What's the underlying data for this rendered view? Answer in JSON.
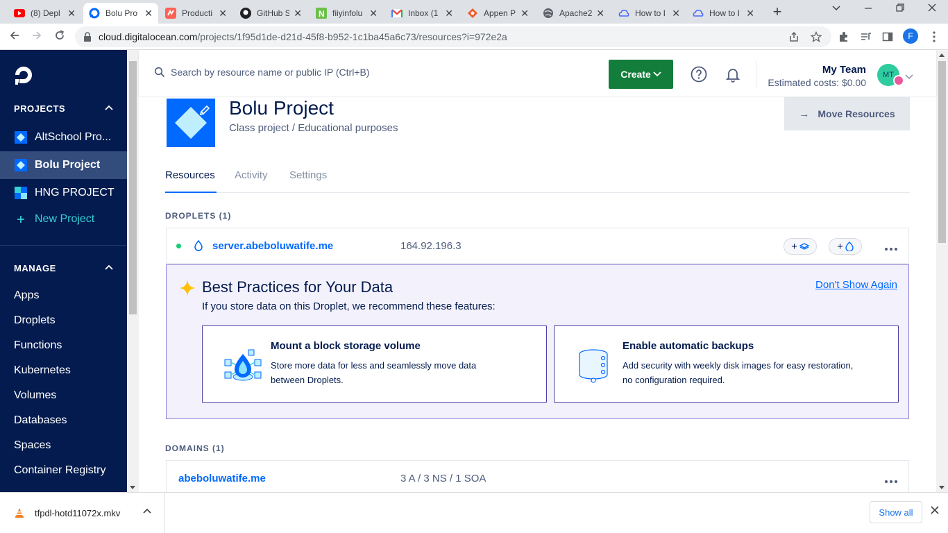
{
  "browser": {
    "tabs": [
      {
        "label": "(8) Depl",
        "icon": "youtube-icon"
      },
      {
        "label": "Bolu Pro",
        "icon": "digitalocean-icon",
        "active": true
      },
      {
        "label": "Producti",
        "icon": "producthunt-icon"
      },
      {
        "label": "GitHub S",
        "icon": "github-icon"
      },
      {
        "label": "fiiyinfolu",
        "icon": "n-icon"
      },
      {
        "label": "Inbox (1",
        "icon": "gmail-icon"
      },
      {
        "label": "Appen P",
        "icon": "appen-icon"
      },
      {
        "label": "Apache2",
        "icon": "globe-icon"
      },
      {
        "label": "How to I",
        "icon": "cloud-icon"
      },
      {
        "label": "How to I",
        "icon": "cloud-icon"
      }
    ],
    "url_host": "cloud.digitalocean.com",
    "url_path": "/projects/1f95d1de-d21d-45f8-b952-1c1ba45a6c73/resources?i=972e2a",
    "profile_initial": "F"
  },
  "sidebar": {
    "projects_heading": "PROJECTS",
    "projects": [
      {
        "label": "AltSchool Pro...",
        "icon": "project-diamond-icon"
      },
      {
        "label": "Bolu Project",
        "icon": "project-diamond-icon",
        "active": true
      },
      {
        "label": "HNG PROJECT",
        "icon": "project-grid-icon"
      }
    ],
    "new_project_label": "New Project",
    "manage_heading": "MANAGE",
    "manage_items": [
      "Apps",
      "Droplets",
      "Functions",
      "Kubernetes",
      "Volumes",
      "Databases",
      "Spaces",
      "Container Registry"
    ]
  },
  "topbar": {
    "search_placeholder": "Search by resource name or public IP (Ctrl+B)",
    "create_label": "Create",
    "team_name": "My Team",
    "estimated_cost": "Estimated costs: $0.00",
    "avatar_initials": "MT"
  },
  "project": {
    "title": "Bolu Project",
    "description": "Class project / Educational purposes",
    "move_resources_label": "Move Resources",
    "tabs": [
      "Resources",
      "Activity",
      "Settings"
    ]
  },
  "droplets": {
    "heading": "DROPLETS (1)",
    "name": "server.abeboluwatife.me",
    "ip": "164.92.196.3",
    "status_color": "#15cd72"
  },
  "best_practices": {
    "title": "Best Practices for Your Data",
    "subtitle": "If you store data on this Droplet, we recommend these features:",
    "dismiss_label": "Don't Show Again",
    "features": [
      {
        "title": "Mount a block storage volume",
        "description": "Store more data for less and seamlessly move data between Droplets.",
        "icon": "block-storage-icon"
      },
      {
        "title": "Enable automatic backups",
        "description": "Add security with weekly disk images for easy restoration, no configuration required.",
        "icon": "backup-database-icon"
      }
    ]
  },
  "domains": {
    "heading": "DOMAINS (1)",
    "name": "abeboluwatife.me",
    "records": "3 A / 3 NS / 1 SOA"
  },
  "downloads": {
    "file_name": "tfpdl-hotd11072x.mkv",
    "show_all_label": "Show all"
  },
  "colors": {
    "sidebar_bg": "#031b4e",
    "accent": "#0069ff",
    "create_green": "#137d3b",
    "best_practice_border": "#8f80d9"
  }
}
